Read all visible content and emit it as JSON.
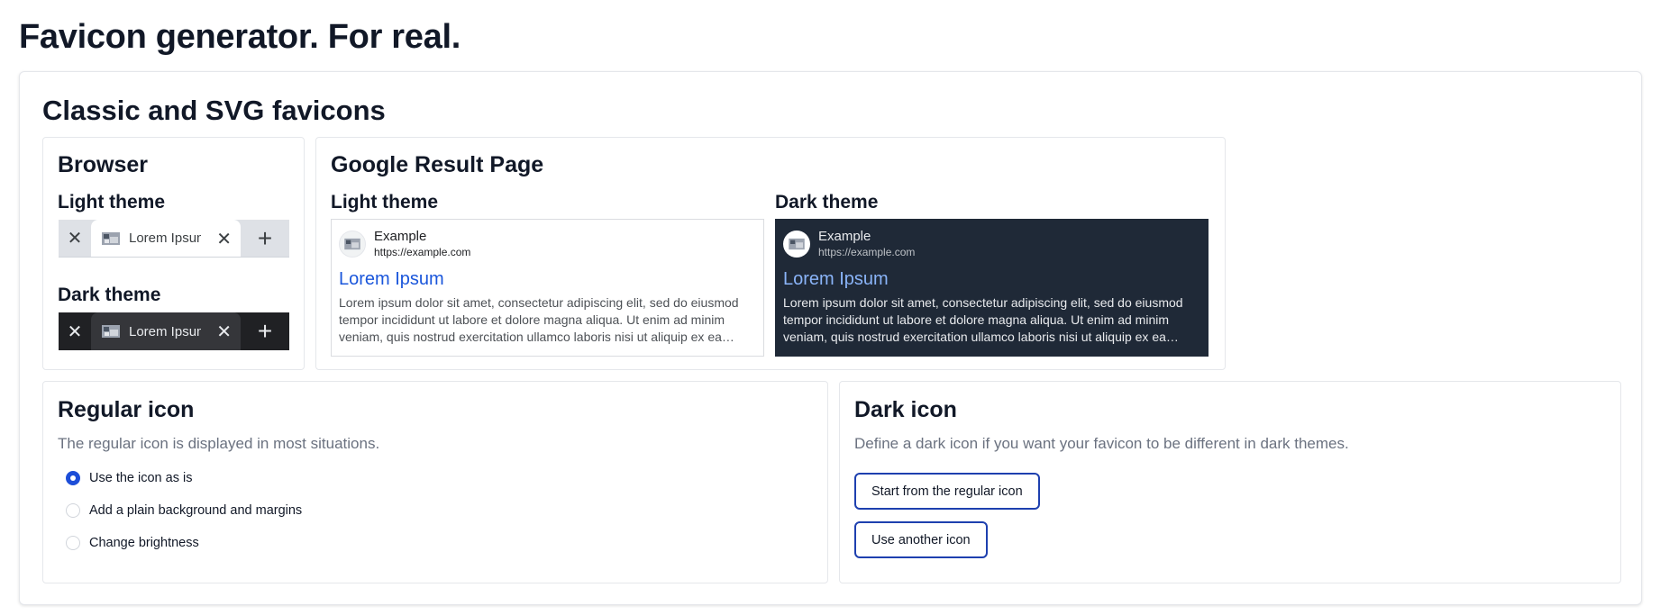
{
  "page": {
    "title": "Favicon generator. For real."
  },
  "classic": {
    "title": "Classic and SVG favicons",
    "browser": {
      "title": "Browser",
      "light_label": "Light theme",
      "dark_label": "Dark theme",
      "tab_label": "Lorem Ipsum",
      "close_glyph": "✕",
      "plus_glyph": "+"
    },
    "google": {
      "title": "Google Result Page",
      "light_label": "Light theme",
      "dark_label": "Dark theme",
      "site_name": "Example",
      "site_url": "https://example.com",
      "result_title": "Lorem Ipsum",
      "snippet": "Lorem ipsum dolor sit amet, consectetur adipiscing elit, sed do eiusmod tempor incididunt ut labore et dolore magna aliqua. Ut enim ad minim veniam, quis nostrud exercitation ullamco laboris nisi ut aliquip ex ea…"
    }
  },
  "regular": {
    "title": "Regular icon",
    "description": "The regular icon is displayed in most situations.",
    "options": [
      {
        "label": "Use the icon as is",
        "checked": true
      },
      {
        "label": "Add a plain background and margins",
        "checked": false
      },
      {
        "label": "Change brightness",
        "checked": false
      }
    ]
  },
  "dark": {
    "title": "Dark icon",
    "description": "Define a dark icon if you want your favicon to be different in dark themes.",
    "start_button": "Start from the regular icon",
    "another_button": "Use another icon"
  },
  "colors": {
    "accent": "#1d4ed8",
    "border": "#e5e7eb",
    "dark_serp_bg": "#1f2937",
    "dark_tab_bg": "#202124",
    "light_tab_bg": "#dee1e6",
    "link_blue": "#1a56db"
  }
}
